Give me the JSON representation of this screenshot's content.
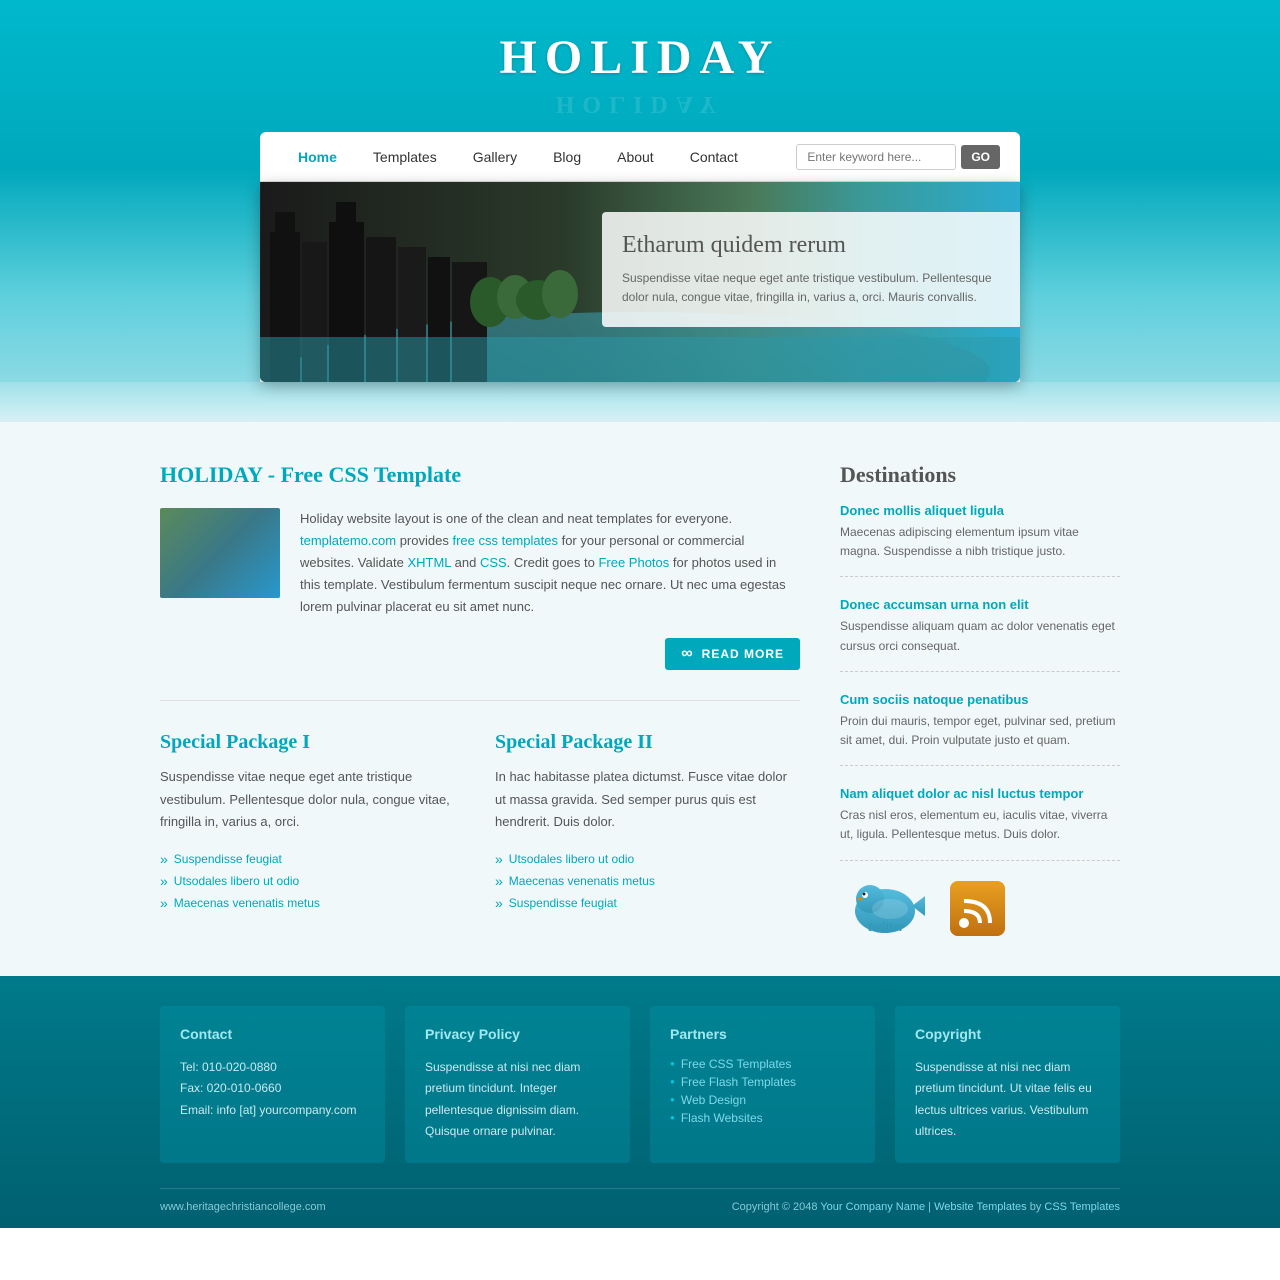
{
  "site": {
    "title": "HOLIDAY",
    "url": "www.heritagechristiancollege.com"
  },
  "nav": {
    "links": [
      {
        "label": "Home",
        "active": true
      },
      {
        "label": "Templates",
        "active": false
      },
      {
        "label": "Gallery",
        "active": false
      },
      {
        "label": "Blog",
        "active": false
      },
      {
        "label": "About",
        "active": false
      },
      {
        "label": "Contact",
        "active": false
      }
    ],
    "search_placeholder": "Enter keyword here...",
    "search_btn": "GO"
  },
  "banner": {
    "title": "Etharum quidem rerum",
    "text": "Suspendisse vitae neque eget ante tristique vestibulum. Pellentesque dolor nula, congue vitae, fringilla in, varius a, orci. Mauris convallis."
  },
  "main": {
    "section_title": "HOLIDAY - Free CSS Template",
    "article_text": "Holiday website layout is one of the clean and neat templates for everyone. templatemo.com provides free css templates for your personal or commercial websites. Validate XHTML and CSS. Credit goes to Free Photos for photos used in this template. Vestibulum fermentum suscipit neque nec ornare. Ut nec uma egestas lorem pulvinar placerat eu sit amet nunc.",
    "read_more": "READ MORE",
    "packages": [
      {
        "title": "Special Package I",
        "text": "Suspendisse vitae neque eget ante tristique vestibulum. Pellentesque dolor nula, congue vitae, fringilla in, varius a, orci.",
        "list": [
          "Suspendisse feugiat",
          "Utsodales libero ut odio",
          "Maecenas venenatis metus"
        ]
      },
      {
        "title": "Special Package II",
        "text": "In hac habitasse platea dictumst. Fusce vitae dolor ut massa gravida. Sed semper purus quis est hendrerit. Duis dolor.",
        "list": [
          "Utsodales libero ut odio",
          "Maecenas venenatis metus",
          "Suspendisse feugiat"
        ]
      }
    ]
  },
  "destinations": {
    "title": "Destinations",
    "items": [
      {
        "title": "Donec mollis aliquet ligula",
        "text": "Maecenas adipiscing elementum ipsum vitae magna. Suspendisse a nibh tristique justo."
      },
      {
        "title": "Donec accumsan urna non elit",
        "text": "Suspendisse aliquam quam ac dolor venenatis eget cursus orci consequat."
      },
      {
        "title": "Cum sociis natoque penatibus",
        "text": "Proin dui mauris, tempor eget, pulvinar sed, pretium sit amet, dui. Proin vulputate justo et quam."
      },
      {
        "title": "Nam aliquet dolor ac nisl luctus tempor",
        "text": "Cras nisl eros, elementum eu, iaculis vitae, viverra ut, ligula. Pellentesque metus. Duis dolor."
      }
    ]
  },
  "footer": {
    "cols": [
      {
        "title": "Contact",
        "lines": [
          "Tel: 010-020-0880",
          "Fax: 020-010-0660",
          "Email: info [at] yourcompany.com"
        ]
      },
      {
        "title": "Privacy Policy",
        "text": "Suspendisse at nisi nec diam pretium tincidunt. Integer pellentesque dignissim diam. Quisque ornare pulvinar."
      },
      {
        "title": "Partners",
        "links": [
          "Free CSS Templates",
          "Free Flash Templates",
          "Web Design",
          "Flash Websites"
        ]
      },
      {
        "title": "Copyright",
        "text": "Suspendisse at nisi nec diam pretium tincidunt. Ut vitae felis eu lectus ultrices varius. Vestibulum ultrices."
      }
    ],
    "bottom_left": "www.heritagechristiancollege.com",
    "copyright": "Copyright © 2048",
    "your_company": "Your Company Name",
    "website_templates": "Website Templates",
    "by": "by",
    "css_templates": "CSS Templates"
  }
}
